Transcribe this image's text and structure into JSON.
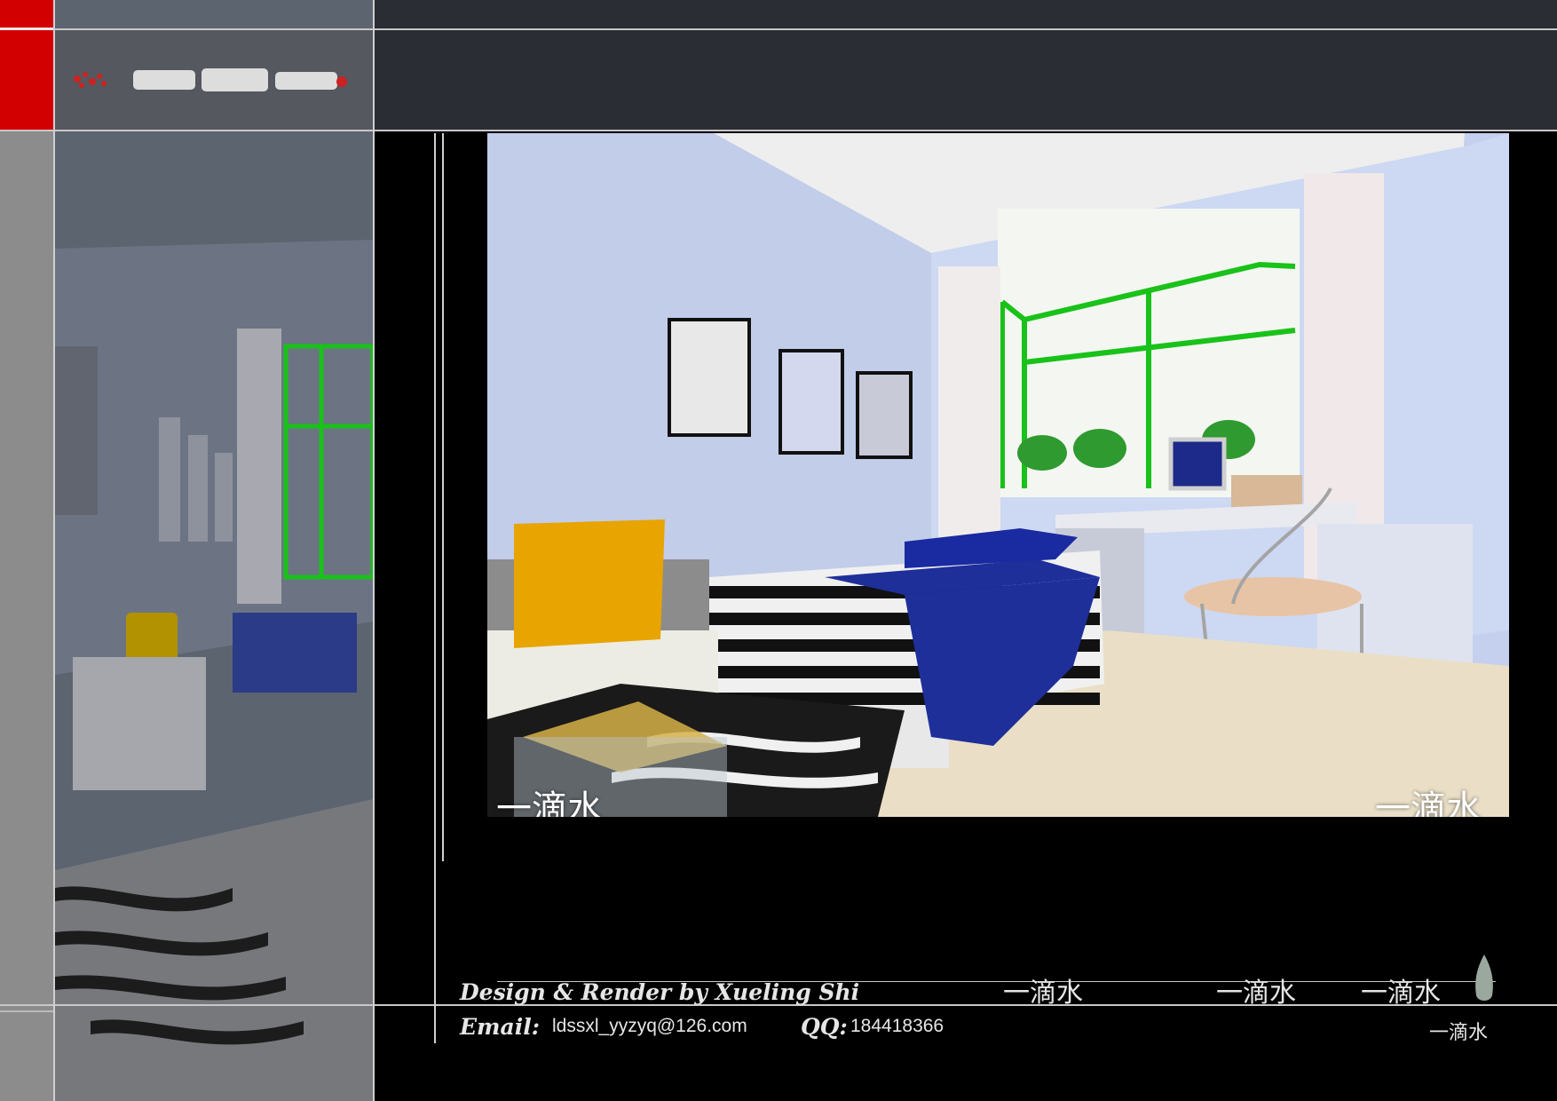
{
  "watermark": {
    "left": "一滴水",
    "right": "一滴水"
  },
  "footer": {
    "credit_line": "Design & Render by Xueling Shi",
    "email_label": "Email:",
    "email_value": "ldssxl_yyzyq@126.com",
    "qq_label": "QQ:",
    "qq_value": "184418366",
    "brand_1": "一滴水",
    "brand_2": "一滴水",
    "brand_3": "一滴水",
    "brand_small": "一滴水"
  },
  "colors": {
    "accent_red": "#d20000",
    "wall_blue": "#c8d2ec",
    "bed_blue": "#1e2f9a",
    "pillow_yellow": "#e8a400",
    "window_green": "#19c219"
  }
}
